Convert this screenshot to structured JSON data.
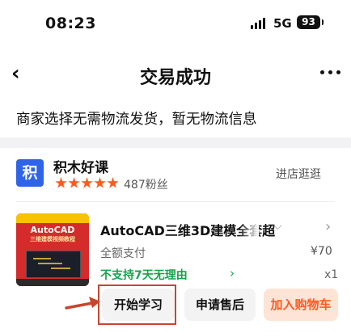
{
  "status_bar": {
    "time": "08:23",
    "network": "5G",
    "battery": "93"
  },
  "nav": {
    "back_icon": "chevron-left-icon",
    "title": "交易成功",
    "more_icon": "more-horizontal-icon"
  },
  "notice": {
    "text": "商家选择无需物流发货，暂无物流信息"
  },
  "shop": {
    "logo_text": "积",
    "name": "积木好课",
    "rating_stars": 5,
    "fans": "487粉丝",
    "visit_label": "进店逛逛"
  },
  "product": {
    "thumbnail": {
      "top_text": "AutoCAD",
      "sub_text": "三维建模视频教程"
    },
    "title": "AutoCAD三维3D建模全套超",
    "pay_type": "全额支付",
    "price": "¥70",
    "return_policy": "不支持7天无理由",
    "quantity": "x1"
  },
  "actions": {
    "start_learning": "开始学习",
    "after_sale": "申请售后",
    "add_to_cart": "加入购物车"
  },
  "colors": {
    "accent": "#ff5a1f",
    "highlight_box": "#c8452e",
    "green": "#17a34a",
    "logo_blue": "#2f64e8"
  }
}
